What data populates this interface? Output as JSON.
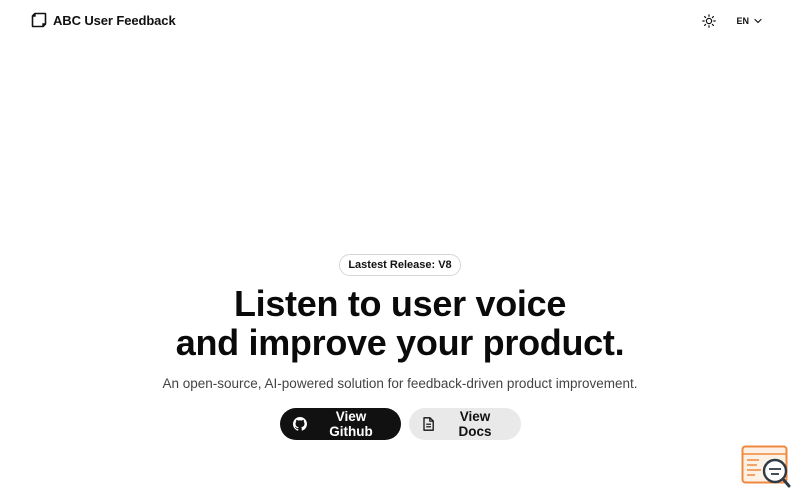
{
  "header": {
    "brand": {
      "name": "ABC User Feedback",
      "logo_icon": "cube-logo-icon"
    },
    "theme_toggle_icon": "sun-icon",
    "language": {
      "selected": "EN",
      "icon": "chevron-down-icon"
    }
  },
  "hero": {
    "release_badge": "Lastest Release: V8",
    "headline_line1": "Listen to user voice",
    "headline_line2": "and improve your product.",
    "subtitle": "An open-source, AI-powered solution for feedback-driven product improvement.",
    "buttons": {
      "github": {
        "label": "View Github",
        "icon": "github-icon"
      },
      "docs": {
        "label": "View Docs",
        "icon": "document-icon"
      }
    }
  },
  "corner_widget": {
    "icon": "search-console-icon"
  },
  "colors": {
    "primary_button_bg": "#111111",
    "secondary_button_bg": "#e9e9e9",
    "widget_accent": "#f0883e"
  }
}
